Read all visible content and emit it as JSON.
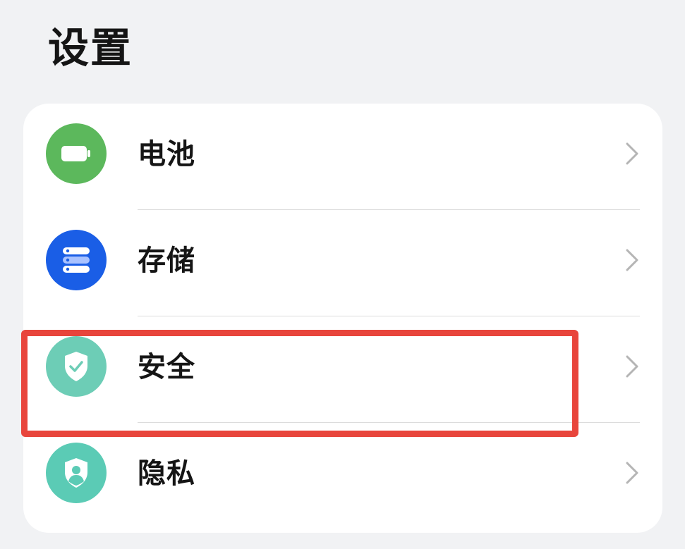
{
  "header": {
    "title": "设置"
  },
  "settings": {
    "items": [
      {
        "label": "电池",
        "icon": "battery-icon",
        "icon_color": "#5cb85c"
      },
      {
        "label": "存储",
        "icon": "storage-icon",
        "icon_color": "#1a5ee6"
      },
      {
        "label": "安全",
        "icon": "security-shield-icon",
        "icon_color": "#6dcdb6"
      },
      {
        "label": "隐私",
        "icon": "privacy-shield-icon",
        "icon_color": "#5bcbb5"
      }
    ]
  },
  "colors": {
    "background": "#f1f2f4",
    "card": "#ffffff",
    "highlight": "#e8453c",
    "chevron": "#b5b5b5"
  }
}
